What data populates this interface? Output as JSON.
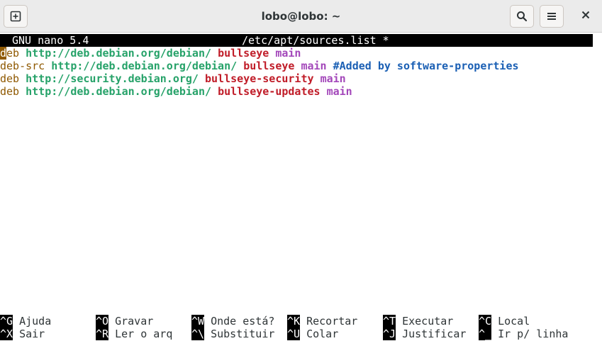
{
  "window": {
    "title": "lobo@lobo: ~"
  },
  "icons": {
    "new_tab": "new-tab-icon",
    "search": "search-icon",
    "menu": "hamburger-menu-icon",
    "close": "close-icon"
  },
  "nano": {
    "version": "GNU nano 5.4",
    "filename": "/etc/apt/sources.list *"
  },
  "lines": [
    {
      "type_first": "d",
      "type_rest": "eb",
      "url": "http://deb.debian.org/debian/",
      "suite": "bullseye",
      "component": "main"
    },
    {
      "type": "deb-src",
      "url": "http://deb.debian.org/debian/",
      "suite": "bullseye",
      "component": "main",
      "comment": "#Added by software-properties"
    },
    {
      "type": "deb",
      "url": "http://security.debian.org/",
      "suite": "bullseye-security",
      "component": "main"
    },
    {
      "type": "deb",
      "url": "http://deb.debian.org/debian/",
      "suite": "bullseye-updates",
      "component": "main"
    }
  ],
  "shortcuts": {
    "row1": [
      {
        "key": "^G",
        "label": "Ajuda"
      },
      {
        "key": "^O",
        "label": "Gravar"
      },
      {
        "key": "^W",
        "label": "Onde está?"
      },
      {
        "key": "^K",
        "label": "Recortar"
      },
      {
        "key": "^T",
        "label": "Executar"
      },
      {
        "key": "^C",
        "label": "Local"
      }
    ],
    "row2": [
      {
        "key": "^X",
        "label": "Sair"
      },
      {
        "key": "^R",
        "label": "Ler o arq"
      },
      {
        "key": "^\\",
        "label": "Substituir"
      },
      {
        "key": "^U",
        "label": "Colar"
      },
      {
        "key": "^J",
        "label": "Justificar"
      },
      {
        "key": "^_",
        "label": "Ir p/ linha"
      }
    ]
  }
}
